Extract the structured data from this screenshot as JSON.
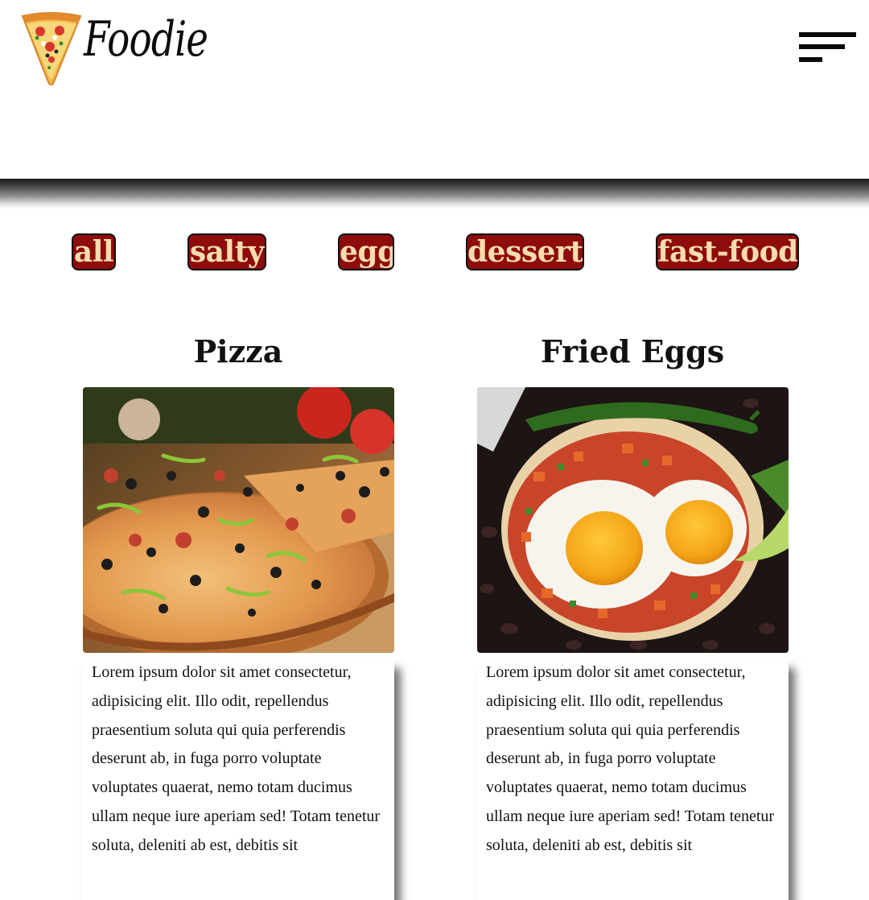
{
  "header": {
    "logo_text": "Foodie",
    "logo_icon": "pizza-slice-icon",
    "menu_icon": "hamburger-menu-icon"
  },
  "filters": [
    {
      "label": "all"
    },
    {
      "label": "salty"
    },
    {
      "label": "egg"
    },
    {
      "label": "dessert"
    },
    {
      "label": "fast-food"
    }
  ],
  "cards": [
    {
      "title": "Pizza",
      "image": "pizza-photo",
      "description": "Lorem ipsum dolor sit amet consectetur, adipisicing elit. Illo odit, repellendus praesentium soluta qui quia perferendis deserunt ab, in fuga porro voluptate voluptates quaerat, nemo totam ducimus ullam neque iure aperiam sed! Totam tenetur soluta, deleniti ab est, debitis sit"
    },
    {
      "title": "Fried Eggs",
      "image": "fried-eggs-photo",
      "description": "Lorem ipsum dolor sit amet consectetur, adipisicing elit. Illo odit, repellendus praesentium soluta qui quia perferendis deserunt ab, in fuga porro voluptate voluptates quaerat, nemo totam ducimus ullam neque iure aperiam sed! Totam tenetur soluta, deleniti ab est, debitis sit"
    }
  ],
  "colors": {
    "filter_background": "#8e0c0c",
    "filter_text": "#f6dcae",
    "header_shadow": "#1b1b1b"
  }
}
